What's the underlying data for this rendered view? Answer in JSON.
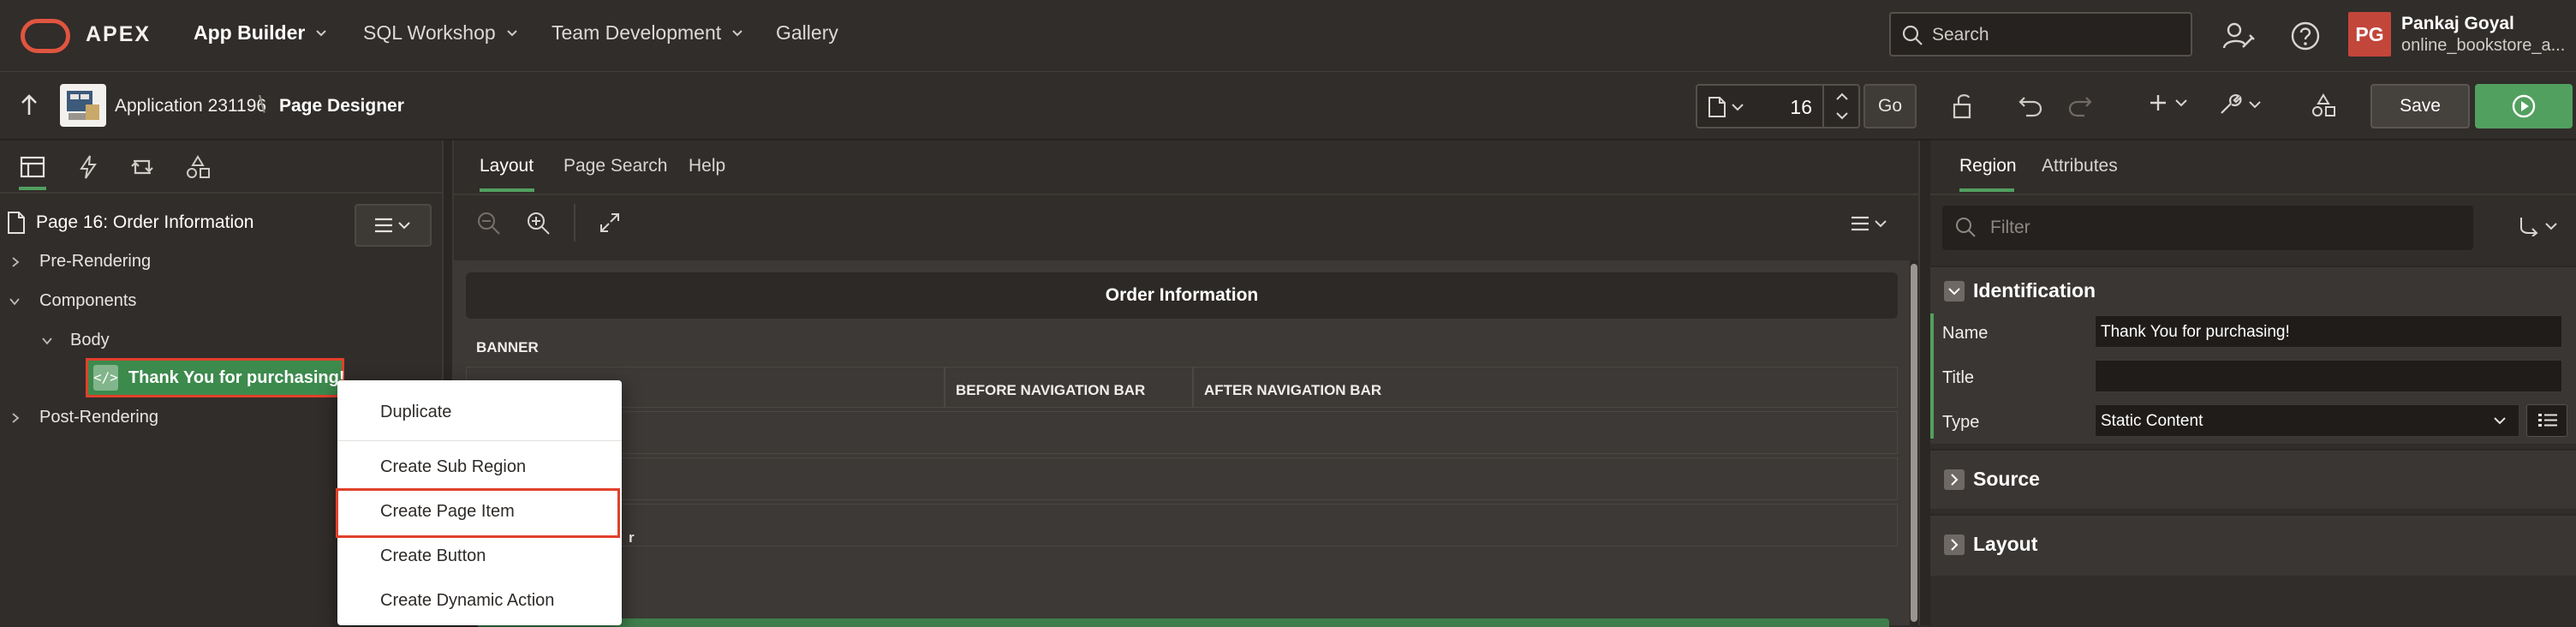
{
  "topbar": {
    "brand": "APEX",
    "nav": [
      {
        "label": "App Builder",
        "has_menu": true
      },
      {
        "label": "SQL Workshop",
        "has_menu": true
      },
      {
        "label": "Team Development",
        "has_menu": true
      },
      {
        "label": "Gallery",
        "has_menu": false
      }
    ],
    "search_placeholder": "Search",
    "user": {
      "initials": "PG",
      "name": "Pankaj Goyal",
      "app": "online_bookstore_a..."
    },
    "brand_color": "#e0553f",
    "avatar_color": "#c2463a"
  },
  "toolbar": {
    "application": "Application 231196",
    "separator": "\\",
    "page_designer": "Page Designer",
    "page_number": "16",
    "go": "Go",
    "save": "Save",
    "run_color": "#52a05f"
  },
  "left": {
    "page_title": "Page 16: Order Information",
    "tree": {
      "pre_rendering": "Pre-Rendering",
      "components": "Components",
      "body": "Body",
      "region": "Thank You for purchasing!",
      "post_rendering": "Post-Rendering"
    }
  },
  "center": {
    "tabs": [
      "Layout",
      "Page Search",
      "Help"
    ],
    "active_tab": "Layout",
    "order_title": "Order Information",
    "banner": "BANNER",
    "slots": [
      "BEFORE NAVIGATION BAR",
      "AFTER NAVIGATION BAR"
    ],
    "partial_char": "r"
  },
  "right": {
    "tabs": [
      "Region",
      "Attributes"
    ],
    "active_tab": "Region",
    "filter_placeholder": "Filter",
    "identification": {
      "title": "Identification",
      "name_label": "Name",
      "name_value": "Thank You for purchasing!",
      "title_label": "Title",
      "title_value": "",
      "type_label": "Type",
      "type_value": "Static Content"
    },
    "source": "Source",
    "layout": "Layout"
  },
  "context_menu": {
    "items": [
      "Duplicate",
      "Create Sub Region",
      "Create Page Item",
      "Create Button",
      "Create Dynamic Action"
    ],
    "highlighted": "Create Page Item"
  }
}
